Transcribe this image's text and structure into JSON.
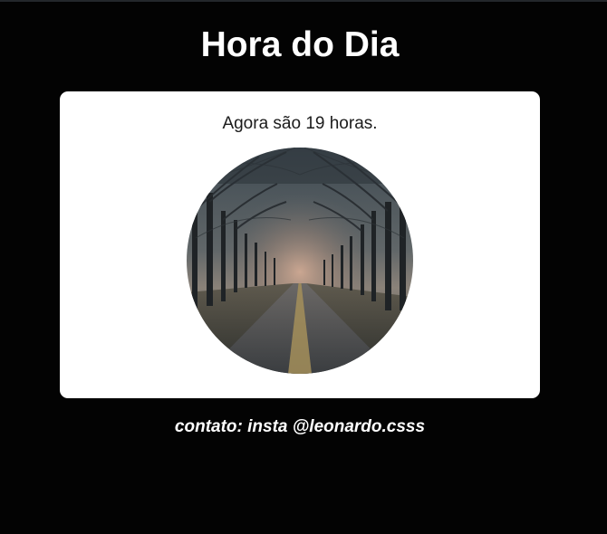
{
  "header": {
    "title": "Hora do Dia"
  },
  "card": {
    "message": "Agora são 19 horas.",
    "photo": {
      "subject": "misty tree-lined road at dusk"
    }
  },
  "footer": {
    "contact": "contato: insta @leonardo.csss"
  },
  "colors": {
    "background": "#030303",
    "card": "#ffffff",
    "title_text": "#ffffff",
    "body_text": "#1b1b1b"
  }
}
